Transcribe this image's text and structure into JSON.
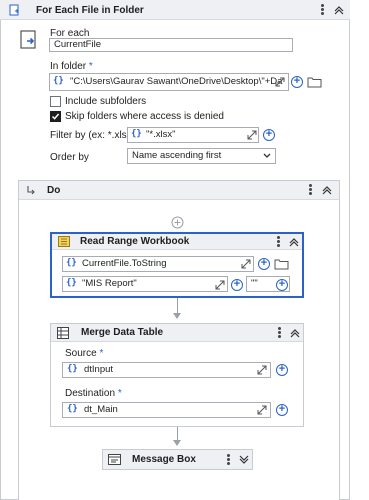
{
  "outer": {
    "title": "For Each File in Folder",
    "for_each_label": "For each",
    "for_each_value": "CurrentFile",
    "in_folder_label": "In folder",
    "required_mark": "*",
    "in_folder_value": "\"C:\\Users\\Gaurav Sawant\\OneDrive\\Desktop\\\"+Da",
    "include_subfolders": "Include subfolders",
    "skip_denied": "Skip folders where access is denied",
    "filter_label": "Filter by (ex: *.xlsx)",
    "filter_value": "\"*.xlsx\"",
    "order_label": "Order by",
    "order_value": "Name ascending first",
    "include_subfolders_checked": false,
    "skip_denied_checked": true
  },
  "do_block": {
    "title": "Do"
  },
  "read_range": {
    "title": "Read Range Workbook",
    "path_value": "CurrentFile.ToString",
    "sheet_value": "\"MIS Report\"",
    "range_value": "\"\""
  },
  "merge": {
    "title": "Merge Data Table",
    "source_label": "Source",
    "source_value": "dtInput",
    "dest_label": "Destination",
    "dest_value": "dt_Main",
    "required_mark": "*"
  },
  "message_box": {
    "title": "Message Box"
  },
  "glyphs": {
    "curly": "{}",
    "plus": "+",
    "dots": "⋮"
  },
  "colors": {
    "accent": "#2a62c9",
    "header_bg": "#eef0f3",
    "selected_border": "#2a62c9"
  }
}
